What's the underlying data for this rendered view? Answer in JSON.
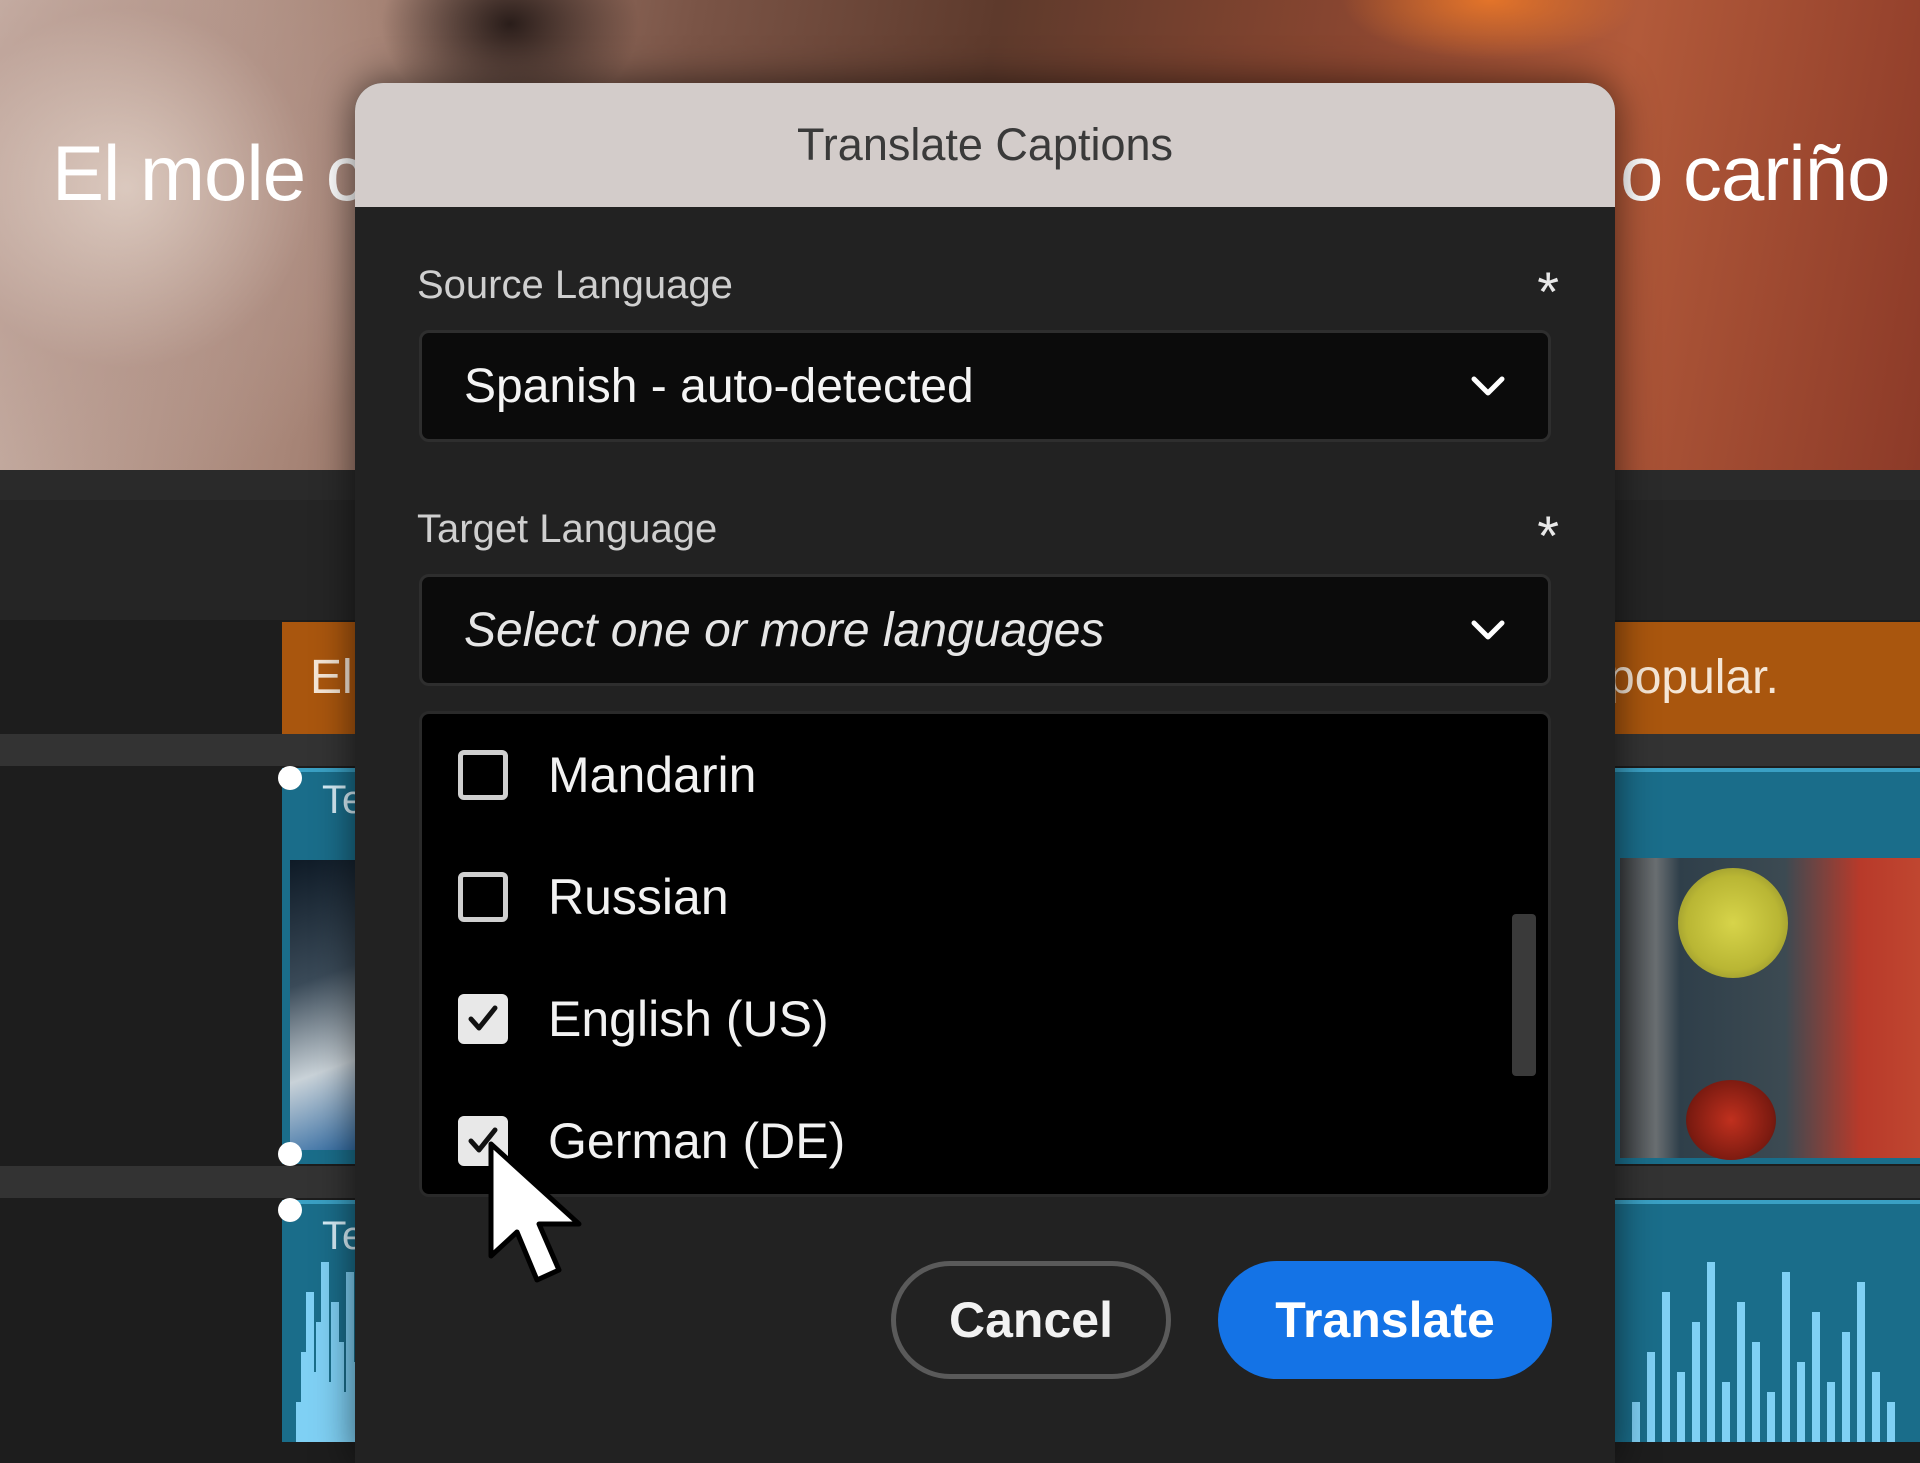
{
  "background": {
    "video_caption_left": "El mole c",
    "video_caption_right": "o cariño",
    "caption_track_left": "El",
    "caption_track_right": "popular.",
    "clip1_label": "Te",
    "clip2_label": "Te"
  },
  "dialog": {
    "title": "Translate Captions",
    "source_language": {
      "label": "Source Language",
      "required_mark": "*",
      "value": "Spanish - auto-detected",
      "icon": "chevron-down-icon"
    },
    "target_language": {
      "label": "Target Language",
      "required_mark": "*",
      "placeholder": "Select one or more languages",
      "icon": "chevron-down-icon"
    },
    "language_options": [
      {
        "label": "Mandarin",
        "checked": false
      },
      {
        "label": "Russian",
        "checked": false
      },
      {
        "label": "English (US)",
        "checked": true
      },
      {
        "label": "German (DE)",
        "checked": true
      }
    ],
    "buttons": {
      "cancel": "Cancel",
      "translate": "Translate"
    },
    "accent_color": "#1473e6"
  }
}
